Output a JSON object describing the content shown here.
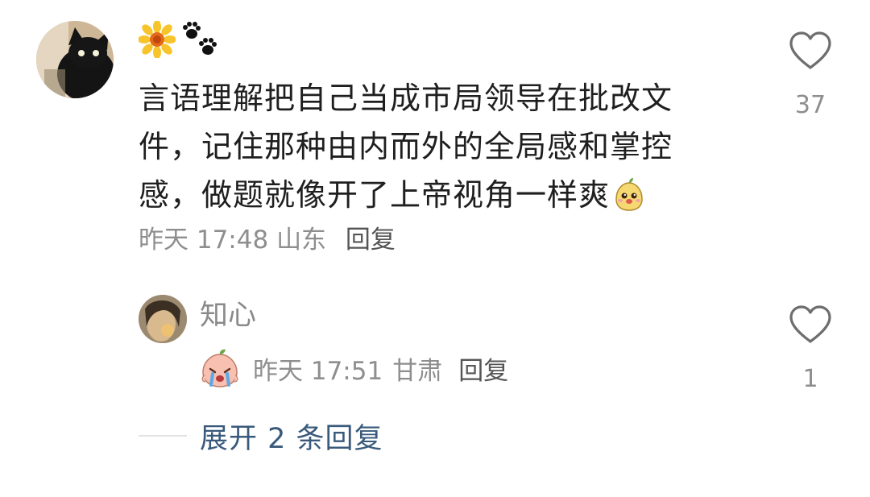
{
  "comment": {
    "avatar": "cat-avatar",
    "name_icons": [
      "sunflower-icon",
      "paw-prints-icon"
    ],
    "text_lines": [
      "言语理解把自己当成市局领导在批改文",
      "件，记住那种由内而外的全局感和掌控",
      "感，做题就像开了上帝视角一样爽"
    ],
    "inline_emoji": "smiling-pear-sticker",
    "date": "昨天 17:48",
    "location": "山东",
    "reply_label": "回复",
    "like_count": "37"
  },
  "reply": {
    "username": "知心",
    "avatar": "person-avatar",
    "sticker": "crying-peach-sticker",
    "date": "昨天 17:51",
    "location": "甘肃",
    "reply_label": "回复",
    "like_count": "1"
  },
  "expand": {
    "label": "展开 2 条回复"
  },
  "colors": {
    "text": "#1f1f1f",
    "meta": "#8e8e8e",
    "link": "#3a5a7c"
  }
}
